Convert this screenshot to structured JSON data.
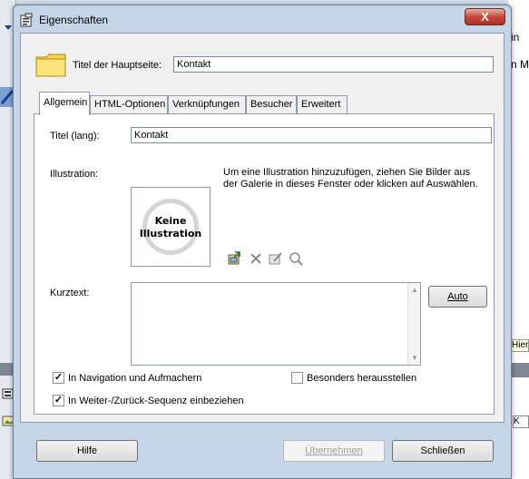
{
  "window": {
    "title": "Eigenschaften",
    "close_glyph": "X"
  },
  "header": {
    "label": "Titel der Hauptseite:",
    "value": "Kontakt"
  },
  "tabs": [
    {
      "label": "Allgemein",
      "active": true
    },
    {
      "label": "HTML-Optionen",
      "active": false
    },
    {
      "label": "Verknüpfungen",
      "active": false
    },
    {
      "label": "Besucher",
      "active": false
    },
    {
      "label": "Erweitert",
      "active": false
    }
  ],
  "general": {
    "title_label": "Titel (lang):",
    "title_value": "Kontakt",
    "illustration_label": "Illustration:",
    "illustration_placeholder_line1": "Keine",
    "illustration_placeholder_line2": "Illustration",
    "illustration_hint": "Um eine Illustration hinzuzufügen, ziehen Sie Bilder aus der Galerie in dieses Fenster oder klicken auf Auswählen.",
    "illustration_tools": [
      "select-image-icon",
      "delete-icon",
      "edit-image-icon",
      "zoom-icon"
    ],
    "short_text_label": "Kurztext:",
    "short_text_value": "",
    "auto_button": "Auto"
  },
  "checkboxes": [
    {
      "label": "In Navigation und Aufmachern",
      "checked": true
    },
    {
      "label": "In Weiter-/Zurück-Sequenz einbeziehen",
      "checked": true
    },
    {
      "label": "Besonders herausstellen",
      "checked": false
    }
  ],
  "buttons": {
    "help": "Hilfe",
    "apply": "Übernehmen",
    "close": "Schließen"
  },
  "background": {
    "right_text_1": "in",
    "right_text_2": "n M",
    "right_tooltip": "Hier",
    "right_box": "K"
  },
  "colors": {
    "dialog_frame": "#c5d5e8",
    "client_bg": "#f0f0f0",
    "close_button": "#c4493a",
    "folder_yellow": "#f7d24b"
  }
}
